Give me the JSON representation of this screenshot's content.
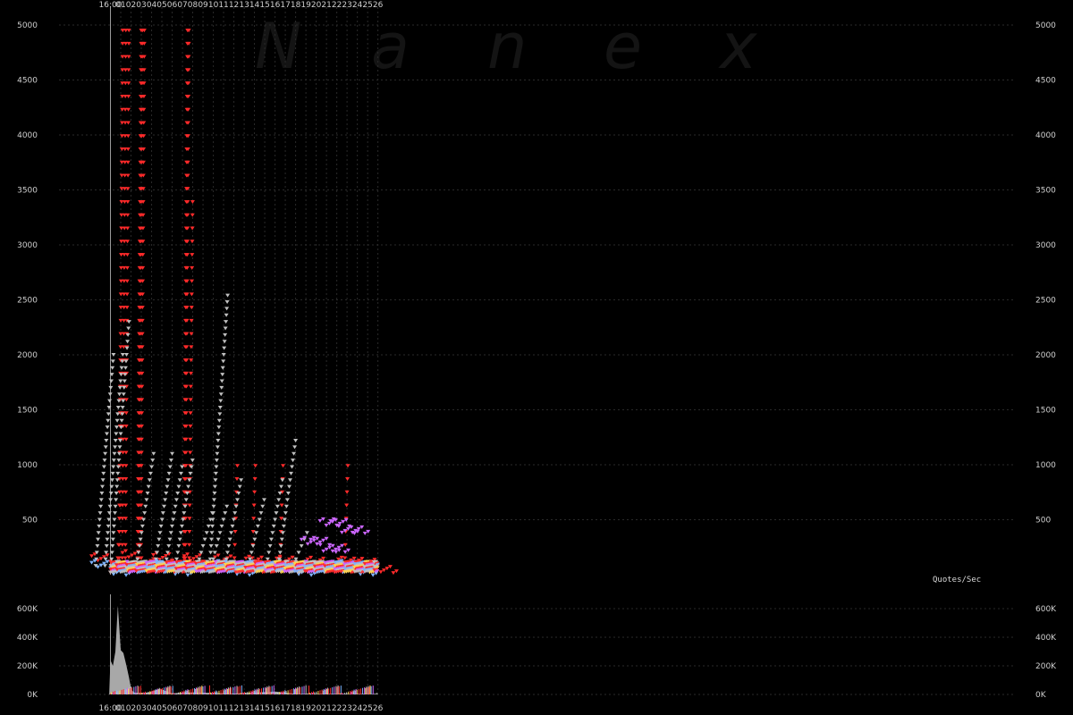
{
  "watermark": [
    "N",
    "a",
    "n",
    "e",
    "x"
  ],
  "chart_data": [
    {
      "type": "scatter",
      "ylabel": "Quotes/Sec",
      "ylim": [
        0,
        5000
      ],
      "yticks": [
        500,
        1000,
        1500,
        2000,
        2500,
        3000,
        3500,
        4000,
        4500,
        5000
      ],
      "xlim": [
        15.9167,
        17.4667
      ],
      "xunit": "hour",
      "xtick_labels": [
        "16:00",
        "01",
        "02",
        "03",
        "04",
        "05",
        "06",
        "07",
        "08",
        "09",
        "10",
        "11",
        "12",
        "13",
        "14",
        "15",
        "16",
        "17",
        "18",
        "19",
        "20",
        "21",
        "22",
        "23",
        "24",
        "25",
        "26"
      ],
      "xtick_values": [
        16.0,
        16.0167,
        16.0333,
        16.05,
        16.0667,
        16.0833,
        16.1,
        16.1167,
        16.1333,
        16.15,
        16.1667,
        16.1833,
        16.2,
        16.2167,
        16.2333,
        16.25,
        16.2667,
        16.2833,
        16.3,
        16.3167,
        16.3333,
        16.35,
        16.3667,
        16.3833,
        16.4,
        16.4167,
        16.4333
      ],
      "grid": true,
      "series": [
        {
          "color": "#ff2a2a",
          "kind": "burst",
          "points": [
            [
              16.0167,
              700
            ],
            [
              16.02,
              5000
            ],
            [
              16.025,
              5000
            ],
            [
              16.03,
              5000
            ],
            [
              16.05,
              5000
            ],
            [
              16.052,
              5000
            ],
            [
              16.055,
              5000
            ],
            [
              16.125,
              5000
            ],
            [
              16.127,
              5000
            ],
            [
              16.1333,
              3500
            ],
            [
              16.206,
              1050
            ],
            [
              16.235,
              1020
            ],
            [
              16.28,
              1050
            ],
            [
              16.385,
              1050
            ]
          ]
        },
        {
          "color": "#ff2a2a",
          "kind": "flat",
          "points": [
            [
              16.0,
              120
            ],
            [
              16.05,
              150
            ],
            [
              16.1,
              130
            ],
            [
              16.15,
              120
            ],
            [
              16.2,
              110
            ],
            [
              16.25,
              100
            ],
            [
              16.3,
              100
            ],
            [
              16.35,
              90
            ],
            [
              16.4,
              90
            ],
            [
              16.433,
              80
            ]
          ]
        },
        {
          "color": "#c0c0c0",
          "kind": "curve",
          "points": [
            [
              16.005,
              2000
            ],
            [
              16.02,
              2000
            ],
            [
              16.07,
              1100
            ],
            [
              16.1,
              1100
            ],
            [
              16.1167,
              1000
            ],
            [
              16.1333,
              1050
            ],
            [
              16.167,
              600
            ],
            [
              16.19,
              650
            ],
            [
              16.213,
              900
            ],
            [
              16.25,
              700
            ],
            [
              16.28,
              900
            ],
            [
              16.3,
              1220
            ],
            [
              16.32,
              400
            ],
            [
              16.03,
              2300
            ],
            [
              16.19,
              2550
            ]
          ]
        },
        {
          "color": "#cc66ff",
          "kind": "flat",
          "points": [
            [
              16.34,
              270
            ],
            [
              16.355,
              270
            ],
            [
              16.37,
              440
            ],
            [
              16.387,
              440
            ]
          ]
        },
        {
          "color": "#7fb3ff",
          "kind": "flat",
          "points": [
            [
              16.0,
              60
            ],
            [
              16.1,
              60
            ],
            [
              16.2,
              60
            ],
            [
              16.3,
              60
            ],
            [
              16.4,
              60
            ]
          ]
        }
      ]
    },
    {
      "type": "area",
      "ylim": [
        0,
        700000
      ],
      "yticks": [
        0,
        200000,
        400000,
        600000
      ],
      "ytick_labels": [
        "0K",
        "200K",
        "400K",
        "600K"
      ],
      "xlim": [
        15.9167,
        17.4667
      ],
      "x": [
        15.998,
        16.0,
        16.004,
        16.008,
        16.012,
        16.0167,
        16.021,
        16.026,
        16.03,
        16.034,
        16.04,
        16.06,
        16.08,
        16.1,
        16.1333,
        16.2,
        16.2667,
        16.3,
        16.4,
        16.4333
      ],
      "values": [
        0,
        240000,
        200000,
        300000,
        620000,
        310000,
        290000,
        200000,
        120000,
        30000,
        12000,
        12000,
        40000,
        8000,
        15000,
        6000,
        20000,
        5000,
        5000,
        3000
      ]
    }
  ]
}
